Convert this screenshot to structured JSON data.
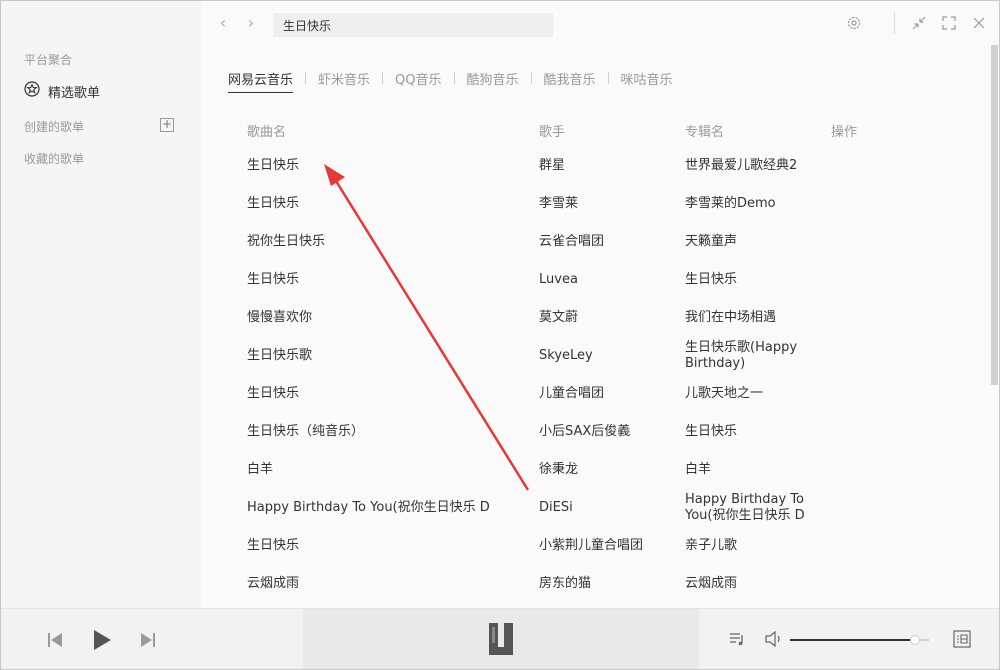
{
  "sidebar": {
    "platform_label": "平台聚合",
    "featured_label": "精选歌单",
    "created_label": "创建的歌单",
    "collected_label": "收藏的歌单"
  },
  "topbar": {
    "search_value": "生日快乐"
  },
  "tabs": [
    "网易云音乐",
    "虾米音乐",
    "QQ音乐",
    "酷狗音乐",
    "酷我音乐",
    "咪咕音乐"
  ],
  "table": {
    "headers": {
      "song": "歌曲名",
      "artist": "歌手",
      "album": "专辑名",
      "action": "操作"
    },
    "rows": [
      {
        "song": "生日快乐",
        "artist": "群星",
        "album": "世界最爱儿歌经典2"
      },
      {
        "song": "生日快乐",
        "artist": "李雪莱",
        "album": "李雪莱的Demo"
      },
      {
        "song": "祝你生日快乐",
        "artist": "云雀合唱团",
        "album": "天籁童声"
      },
      {
        "song": "生日快乐",
        "artist": "Luvea",
        "album": "生日快乐"
      },
      {
        "song": "慢慢喜欢你",
        "artist": "莫文蔚",
        "album": "我们在中场相遇"
      },
      {
        "song": "生日快乐歌",
        "artist": "SkyeLey",
        "album": "生日快乐歌(Happy Birthday)"
      },
      {
        "song": "生日快乐",
        "artist": "儿童合唱团",
        "album": "儿歌天地之一"
      },
      {
        "song": "生日快乐（纯音乐）",
        "artist": "小后SAX后俊義",
        "album": "生日快乐"
      },
      {
        "song": "白羊",
        "artist": "徐秉龙",
        "album": "白羊"
      },
      {
        "song": "Happy Birthday To You(祝你生日快乐 D",
        "artist": "DiESi",
        "album": "Happy Birthday To You(祝你生日快乐 D"
      },
      {
        "song": "生日快乐",
        "artist": "小紫荆儿童合唱团",
        "album": "亲子儿歌"
      },
      {
        "song": "云烟成雨",
        "artist": "房东的猫",
        "album": "云烟成雨"
      }
    ]
  },
  "player": {
    "volume_level": 0.9
  },
  "colors": {
    "annotation_arrow": "#e53935",
    "accent_text": "#333333",
    "muted_text": "#9a9a9a"
  },
  "icons": [
    "star-circle-icon",
    "plus-box-icon",
    "back-arrow-icon",
    "forward-arrow-icon",
    "settings-icon",
    "minimize-icon",
    "fullscreen-icon",
    "close-icon",
    "previous-track-icon",
    "play-icon",
    "next-track-icon",
    "playlist-icon",
    "volume-icon",
    "lyrics-icon"
  ]
}
